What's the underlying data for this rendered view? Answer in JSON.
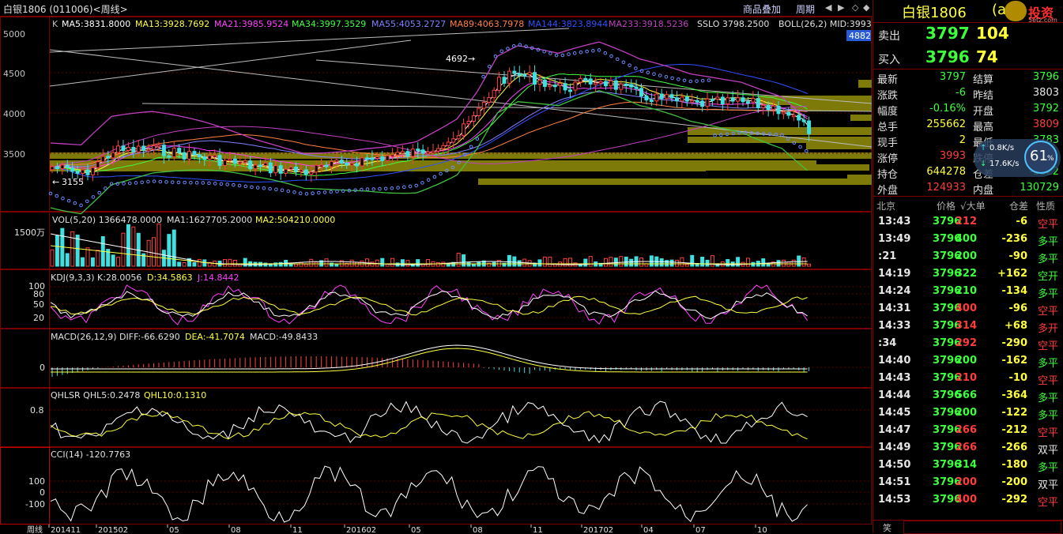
{
  "window": {
    "title": "白银1806 (011006)<周线>",
    "menu_overlay": "商品叠加",
    "menu_period": "周期"
  },
  "main_chart": {
    "k_label": "K",
    "ma5": "MA5:3831.8000",
    "ma13": "MA13:3928.7692",
    "ma21": "MA21:3985.9524",
    "ma34": "MA34:3997.3529",
    "ma55": "MA55:4053.2727",
    "ma89": "MA89:4063.7978",
    "ma144": "MA144:3823.8944",
    "ma233": "MA233:3918.5236",
    "sslo": "SSLO 3798.2500",
    "boll": "BOLL(26,2) MID:3993",
    "price_badge": "4882",
    "y_ticks": [
      "5000",
      "4500",
      "4000",
      "3500"
    ],
    "high_mark": "4692",
    "low_mark": "3155"
  },
  "vol_panel": {
    "header": "VOL(5,20) 1366478.0000",
    "ma1": "MA1:1627705.2000",
    "ma2": "MA2:504210.0000",
    "y_tick": "1500万"
  },
  "kdj_panel": {
    "header": "KDJ(9,3,3) K:28.0056",
    "d": "D:34.5863",
    "j": "J:14.8442",
    "y_ticks": [
      "100",
      "80",
      "50",
      "20"
    ]
  },
  "macd_panel": {
    "header": "MACD(26,12,9) DIFF:-66.6290",
    "dea": "DEA:-41.7074",
    "macd": "MACD:-49.8433",
    "y_tick": "0"
  },
  "qhlsr_panel": {
    "header": "QHLSR  QHL5:0.2478",
    "qhl10": "QHL10:0.1310",
    "y_tick": "0.8"
  },
  "cci_panel": {
    "header": "CCI(14) -120.7763",
    "y_ticks": [
      "100",
      "0",
      "-100"
    ]
  },
  "x_axis": {
    "unit": "周线",
    "labels": [
      "201411",
      "201502",
      "05",
      "08",
      "11",
      "201602",
      "05",
      "08",
      "11",
      "201702",
      "04",
      "07",
      "10"
    ]
  },
  "quote": {
    "name": "白银1806",
    "code_partial": "(a",
    "brand": "投资",
    "brand_site": "5etz.com",
    "ask_label": "卖出",
    "ask_price": "3797",
    "ask_vol": "104",
    "bid_label": "买入",
    "bid_price": "3796",
    "bid_vol": "74",
    "rows": [
      {
        "l1": "最新",
        "v1": "3797",
        "c1": "green",
        "l2": "结算",
        "v2": "3796",
        "c2": "green"
      },
      {
        "l1": "涨跌",
        "v1": "-6",
        "c1": "green",
        "l2": "昨结",
        "v2": "3803",
        "c2": "white"
      },
      {
        "l1": "幅度",
        "v1": "-0.16%",
        "c1": "green",
        "l2": "开盘",
        "v2": "3792",
        "c2": "green"
      },
      {
        "l1": "总手",
        "v1": "255662",
        "c1": "yellow",
        "l2": "最高",
        "v2": "3809",
        "c2": "red"
      },
      {
        "l1": "现手",
        "v1": "2",
        "c1": "yellow",
        "l2": "最低",
        "v2": "3783",
        "c2": "green"
      },
      {
        "l1": "涨停",
        "v1": "3993",
        "c1": "red",
        "l2": "跌停",
        "v2": "",
        "c2": "green"
      },
      {
        "l1": "持仓",
        "v1": "644278",
        "c1": "yellow",
        "l2": "仓差",
        "v2": "-3622",
        "c2": "green"
      },
      {
        "l1": "外盘",
        "v1": "124933",
        "c1": "red",
        "l2": "内盘",
        "v2": "130729",
        "c2": "green"
      }
    ],
    "speed": {
      "up": "0.8K/s",
      "down": "17.6K/s",
      "percent": "61",
      "unit": "%"
    }
  },
  "ticks_header": {
    "time": "北京",
    "price": "价格",
    "vol": "√大单",
    "diff": "仓差",
    "type": "性质"
  },
  "ticks": [
    {
      "t": "13:43",
      "p": "3796",
      "v": "212",
      "vc": "red",
      "d": "-6",
      "ty": "空平",
      "tc": "red"
    },
    {
      "t": "13:49",
      "p": "3796",
      "v": "400",
      "vc": "green",
      "d": "-236",
      "ty": "多平",
      "tc": "green"
    },
    {
      "t": ":21",
      "p": "3796",
      "v": "200",
      "vc": "green",
      "d": "-90",
      "ty": "多平",
      "tc": "green"
    },
    {
      "t": "14:19",
      "p": "3796",
      "v": "322",
      "vc": "green",
      "d": "+162",
      "ty": "空开",
      "tc": "green"
    },
    {
      "t": "14:24",
      "p": "3796",
      "v": "210",
      "vc": "green",
      "d": "-134",
      "ty": "多平",
      "tc": "green"
    },
    {
      "t": "14:31",
      "p": "3796",
      "v": "400",
      "vc": "red",
      "d": "-96",
      "ty": "空平",
      "tc": "red"
    },
    {
      "t": "14:33",
      "p": "3796",
      "v": "314",
      "vc": "red",
      "d": "+68",
      "ty": "多开",
      "tc": "red"
    },
    {
      "t": ":34",
      "p": "3796",
      "v": "292",
      "vc": "red",
      "d": "-290",
      "ty": "空平",
      "tc": "red"
    },
    {
      "t": "14:40",
      "p": "3796",
      "v": "200",
      "vc": "green",
      "d": "-162",
      "ty": "多平",
      "tc": "green"
    },
    {
      "t": "14:43",
      "p": "3796",
      "v": "210",
      "vc": "red",
      "d": "-10",
      "ty": "空平",
      "tc": "red"
    },
    {
      "t": "14:44",
      "p": "3796",
      "v": "566",
      "vc": "green",
      "d": "-364",
      "ty": "多平",
      "tc": "green"
    },
    {
      "t": "14:45",
      "p": "3796",
      "v": "200",
      "vc": "green",
      "d": "-122",
      "ty": "多平",
      "tc": "green"
    },
    {
      "t": "14:47",
      "p": "3796",
      "v": "266",
      "vc": "red",
      "d": "-212",
      "ty": "空平",
      "tc": "red"
    },
    {
      "t": "14:49",
      "p": "3796",
      "v": "266",
      "vc": "red",
      "d": "-266",
      "ty": "双平",
      "tc": "white"
    },
    {
      "t": "14:50",
      "p": "3796",
      "v": "314",
      "vc": "green",
      "d": "-180",
      "ty": "多平",
      "tc": "green"
    },
    {
      "t": "14:51",
      "p": "3796",
      "v": "200",
      "vc": "red",
      "d": "-200",
      "ty": "双平",
      "tc": "white"
    },
    {
      "t": "14:53",
      "p": "3796",
      "v": "400",
      "vc": "red",
      "d": "-292",
      "ty": "空平",
      "tc": "red"
    }
  ],
  "footer_partial": "笑"
}
